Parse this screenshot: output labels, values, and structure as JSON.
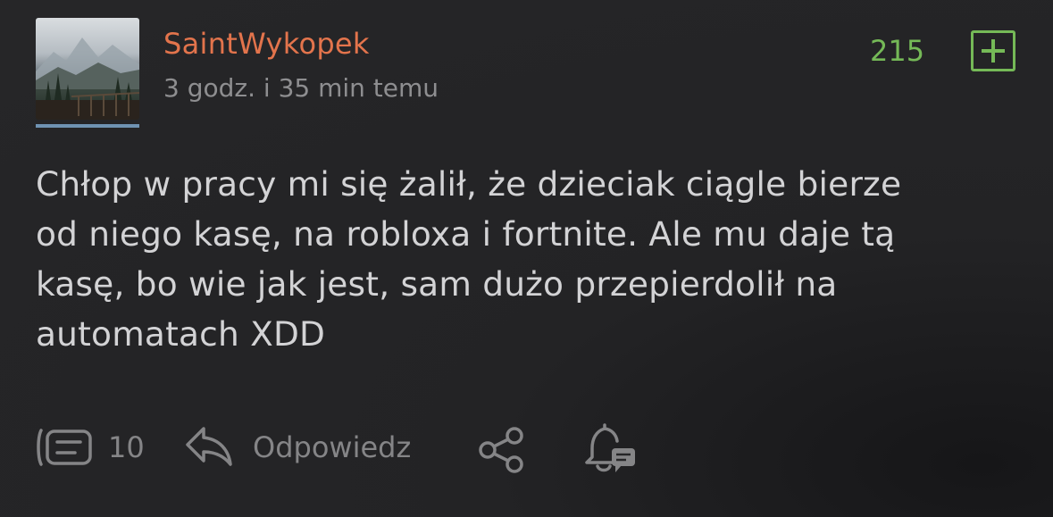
{
  "post": {
    "author": "SaintWykopek",
    "timestamp": "3 godz. i 35 min temu",
    "score": "215",
    "body": "Chłop w pracy mi się żalił, że dzieciak ciągle bierze\nod niego kasę, na robloxa i fortnite. Ale mu daje tą\nkasę, bo wie jak jest, sam dużo przepierdolił na\nautomatach XDD"
  },
  "actions": {
    "comments_count": "10",
    "reply_label": "Odpowiedz"
  },
  "colors": {
    "background": "#262628",
    "author": "#e3744c",
    "score": "#75b957",
    "text": "#d3d3d5",
    "muted": "#858587",
    "avatar_underline": "#6f93b3"
  },
  "icons": [
    "comments-icon",
    "reply-icon",
    "share-icon",
    "bell-icon",
    "plus-icon"
  ]
}
